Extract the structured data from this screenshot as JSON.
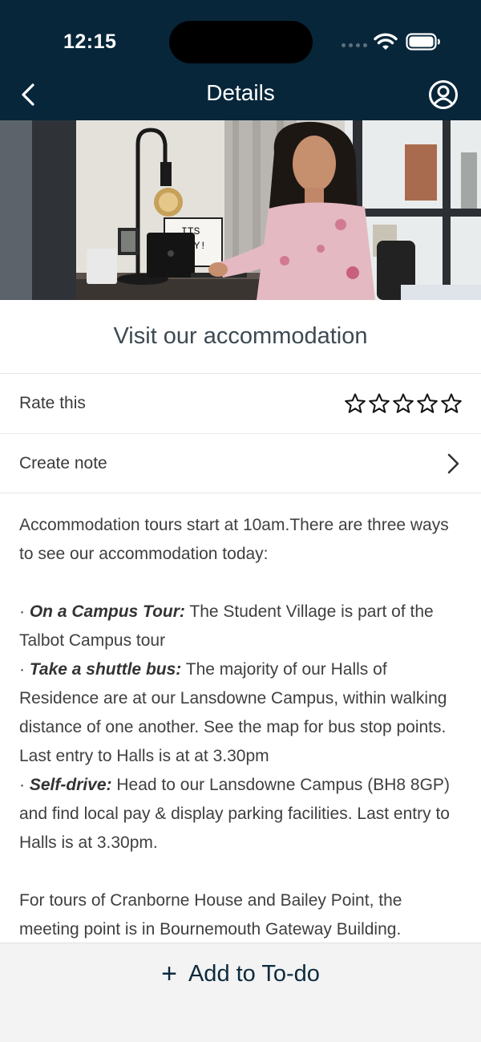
{
  "status_bar": {
    "time": "12:15"
  },
  "nav": {
    "title": "Details",
    "back_icon": "chevron-left-icon",
    "profile_icon": "user-circle-icon"
  },
  "hero_image": {
    "sign_text_line1": "ITS",
    "sign_text_line2": "DAY!"
  },
  "event": {
    "title": "Visit our accommodation"
  },
  "rating": {
    "label": "Rate this",
    "max_stars": 5,
    "current": 0
  },
  "note": {
    "label": "Create note"
  },
  "description": {
    "intro": "Accommodation tours start at 10am.There are three ways to see our accommodation today:",
    "options": [
      {
        "bullet": "·",
        "heading": "On a Campus Tour:",
        "text": " The Student Village is part of the Talbot Campus tour"
      },
      {
        "bullet": "·",
        "heading": "Take a shuttle bus:",
        "text": " The majority of our Halls of Residence are at our Lansdowne Campus, within walking distance of one another. See the map for bus stop points. Last entry to Halls is at at 3.30pm"
      },
      {
        "bullet": "·",
        "heading": "Self-drive:",
        "text": " Head to our Lansdowne Campus (BH8 8GP) and find local pay & display parking facilities. Last entry to Halls is at 3.30pm."
      }
    ],
    "footer": "For tours of Cranborne House and Bailey Point, the meeting point is in Bournemouth Gateway Building."
  },
  "actions": {
    "add_todo_label": "Add to To-do",
    "add_icon": "plus-icon"
  },
  "colors": {
    "header_bg": "#08263a",
    "accent_text": "#0d2b3e",
    "bottom_bar_bg": "#f3f3f3"
  }
}
